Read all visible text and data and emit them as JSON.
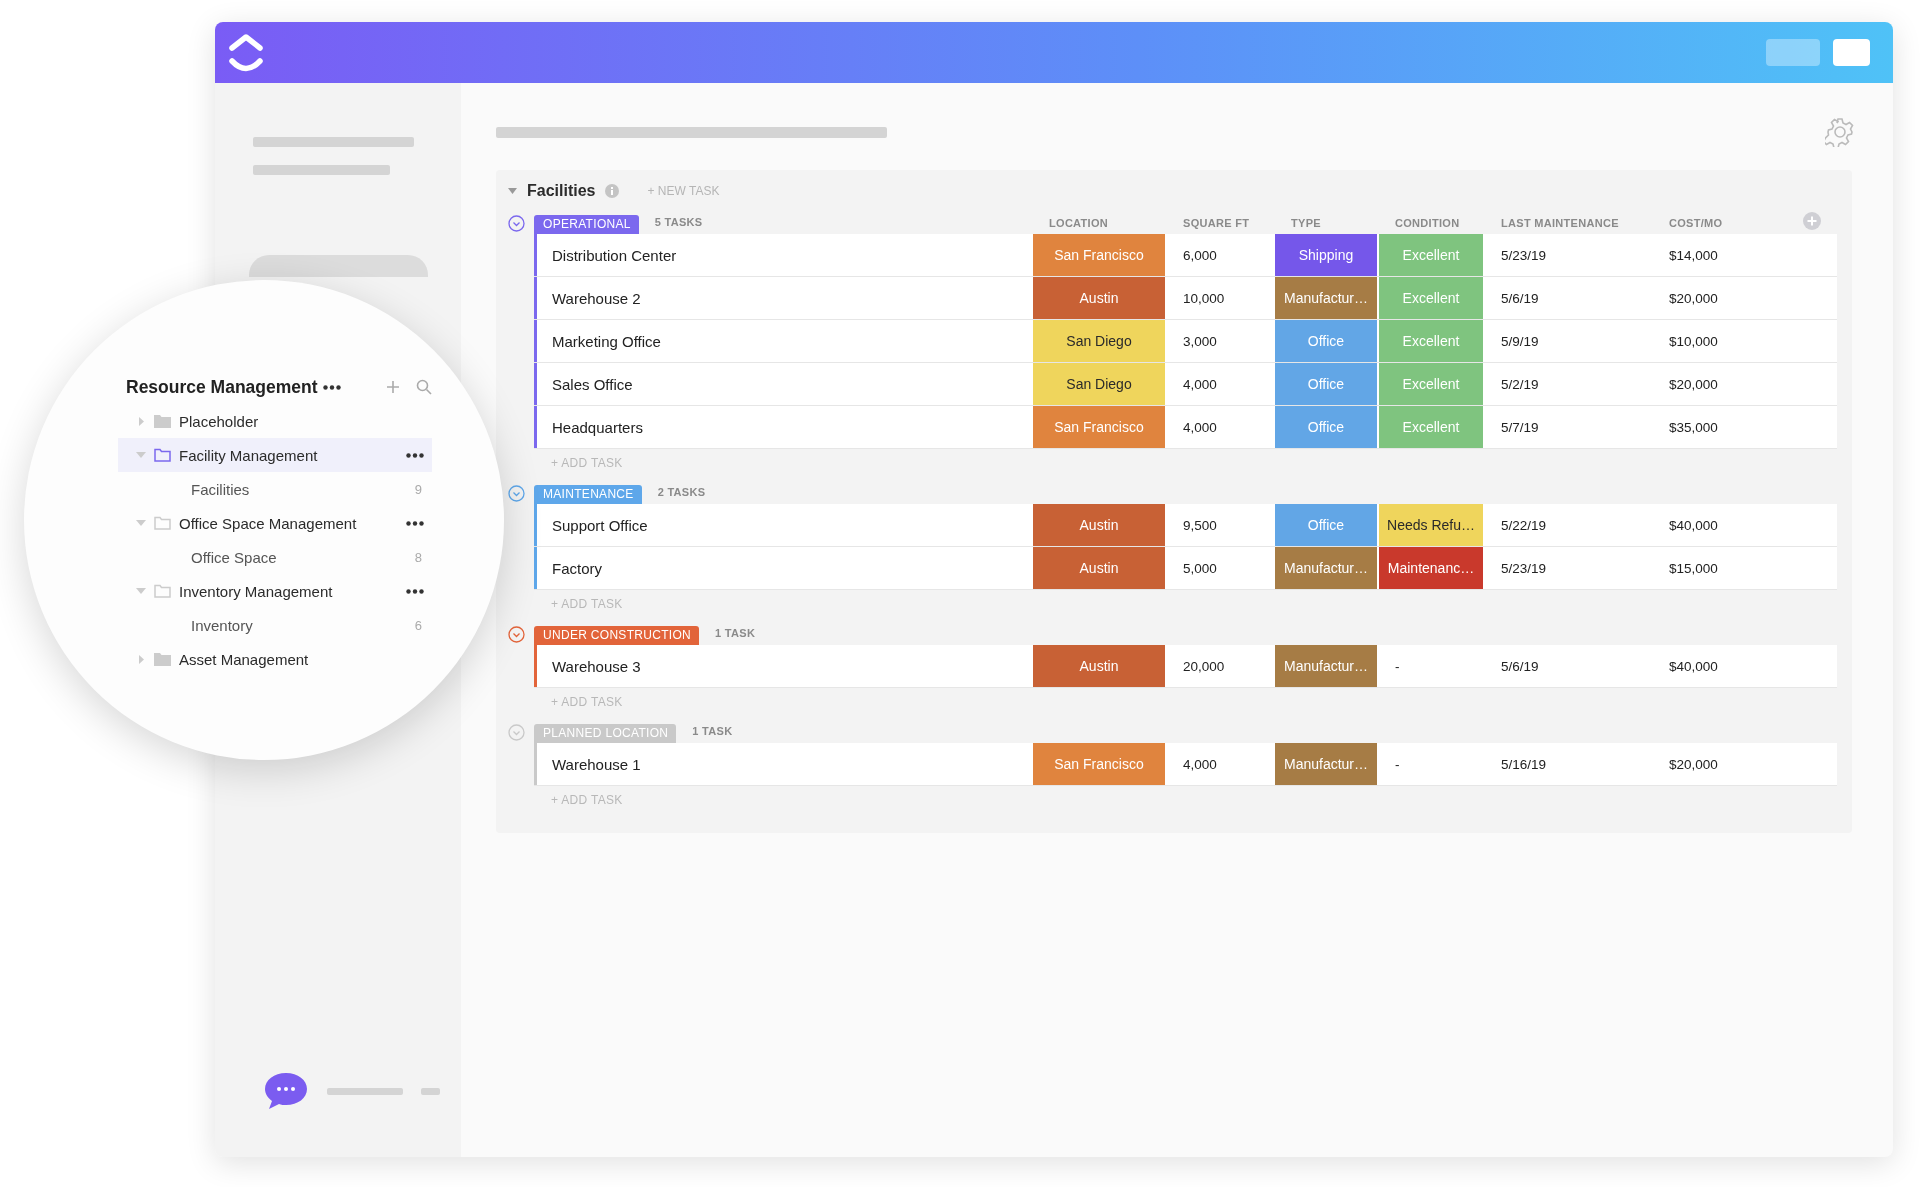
{
  "sidebar": {
    "title": "Resource Management",
    "items": [
      {
        "label": "Placeholder",
        "expanded": false,
        "selected": false
      },
      {
        "label": "Facility Management",
        "expanded": true,
        "selected": true,
        "children": [
          {
            "label": "Facilities",
            "count": "9"
          }
        ]
      },
      {
        "label": "Office Space Management",
        "expanded": true,
        "selected": false,
        "children": [
          {
            "label": "Office Space",
            "count": "8"
          }
        ]
      },
      {
        "label": "Inventory Management",
        "expanded": true,
        "selected": false,
        "children": [
          {
            "label": "Inventory",
            "count": "6"
          }
        ]
      },
      {
        "label": "Asset Management",
        "expanded": false,
        "selected": false
      }
    ]
  },
  "main": {
    "title": "Facilities",
    "new_task": "+ NEW TASK",
    "columns": [
      "LOCATION",
      "SQUARE FT",
      "TYPE",
      "CONDITION",
      "LAST MAINTENANCE",
      "COST/MO"
    ],
    "groups": [
      {
        "status": "OPERATIONAL",
        "color": "#7b68ee",
        "count": "5 TASKS",
        "add_task": "+ ADD TASK",
        "rows": [
          {
            "name": "Distribution Center",
            "location": {
              "text": "San Francisco",
              "color": "#e0843e"
            },
            "sqft": "6,000",
            "type": {
              "text": "Shipping",
              "color": "#7557ea"
            },
            "condition": {
              "text": "Excellent",
              "color": "#7fc47f"
            },
            "last_maintenance": "5/23/19",
            "cost": "$14,000"
          },
          {
            "name": "Warehouse 2",
            "location": {
              "text": "Austin",
              "color": "#c86135"
            },
            "sqft": "10,000",
            "type": {
              "text": "Manufactur…",
              "color": "#a67c45"
            },
            "condition": {
              "text": "Excellent",
              "color": "#7fc47f"
            },
            "last_maintenance": "5/6/19",
            "cost": "$20,000"
          },
          {
            "name": "Marketing Office",
            "location": {
              "text": "San Diego",
              "color": "#efd55c"
            },
            "sqft": "3,000",
            "type": {
              "text": "Office",
              "color": "#62a6e6"
            },
            "condition": {
              "text": "Excellent",
              "color": "#7fc47f"
            },
            "last_maintenance": "5/9/19",
            "cost": "$10,000"
          },
          {
            "name": "Sales Office",
            "location": {
              "text": "San Diego",
              "color": "#efd55c"
            },
            "sqft": "4,000",
            "type": {
              "text": "Office",
              "color": "#62a6e6"
            },
            "condition": {
              "text": "Excellent",
              "color": "#7fc47f"
            },
            "last_maintenance": "5/2/19",
            "cost": "$20,000"
          },
          {
            "name": "Headquarters",
            "location": {
              "text": "San Francisco",
              "color": "#e0843e"
            },
            "sqft": "4,000",
            "type": {
              "text": "Office",
              "color": "#62a6e6"
            },
            "condition": {
              "text": "Excellent",
              "color": "#7fc47f"
            },
            "last_maintenance": "5/7/19",
            "cost": "$35,000"
          }
        ]
      },
      {
        "status": "MAINTENANCE",
        "color": "#5ea7ea",
        "count": "2 TASKS",
        "add_task": "+ ADD TASK",
        "rows": [
          {
            "name": "Support Office",
            "location": {
              "text": "Austin",
              "color": "#c86135"
            },
            "sqft": "9,500",
            "type": {
              "text": "Office",
              "color": "#62a6e6"
            },
            "condition": {
              "text": "Needs Refu…",
              "color": "#efd55c"
            },
            "last_maintenance": "5/22/19",
            "cost": "$40,000"
          },
          {
            "name": "Factory",
            "location": {
              "text": "Austin",
              "color": "#c86135"
            },
            "sqft": "5,000",
            "type": {
              "text": "Manufactur…",
              "color": "#a67c45"
            },
            "condition": {
              "text": "Maintenanc…",
              "color": "#c9392c"
            },
            "last_maintenance": "5/23/19",
            "cost": "$15,000"
          }
        ]
      },
      {
        "status": "UNDER CONSTRUCTION",
        "color": "#e2643a",
        "count": "1 TASK",
        "add_task": "+ ADD TASK",
        "rows": [
          {
            "name": "Warehouse 3",
            "location": {
              "text": "Austin",
              "color": "#c86135"
            },
            "sqft": "20,000",
            "type": {
              "text": "Manufactur…",
              "color": "#a67c45"
            },
            "condition": {
              "text": "-"
            },
            "last_maintenance": "5/6/19",
            "cost": "$40,000"
          }
        ]
      },
      {
        "status": "PLANNED LOCATION",
        "color": "#c9c9c9",
        "count": "1 TASK",
        "add_task": "+ ADD TASK",
        "rows": [
          {
            "name": "Warehouse 1",
            "location": {
              "text": "San Francisco",
              "color": "#e0843e"
            },
            "sqft": "4,000",
            "type": {
              "text": "Manufactur…",
              "color": "#a67c45"
            },
            "condition": {
              "text": "-"
            },
            "last_maintenance": "5/16/19",
            "cost": "$20,000"
          }
        ]
      }
    ]
  }
}
